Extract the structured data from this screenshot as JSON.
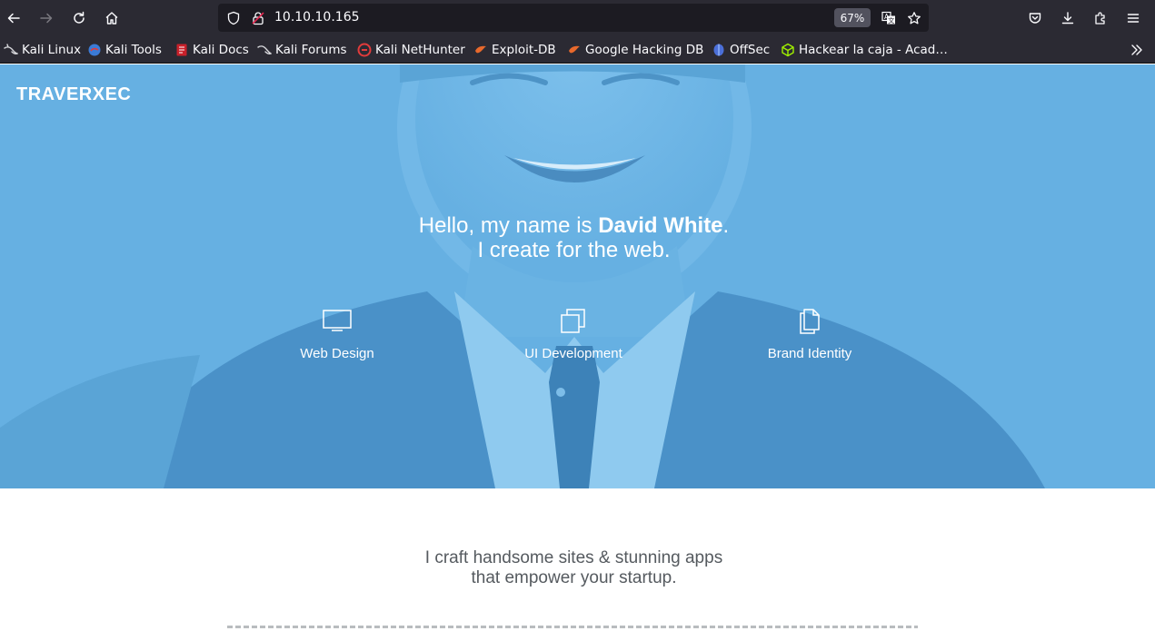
{
  "browser": {
    "url": "10.10.10.165",
    "zoom": "67%",
    "bookmarks": [
      {
        "label": "Kali Linux",
        "icon": "kali-dragon-icon"
      },
      {
        "label": "Kali Tools",
        "icon": "kali-tools-icon"
      },
      {
        "label": "Kali Docs",
        "icon": "kali-docs-icon"
      },
      {
        "label": "Kali Forums",
        "icon": "kali-dragon-icon"
      },
      {
        "label": "Kali NetHunter",
        "icon": "nethunter-icon"
      },
      {
        "label": "Exploit-DB",
        "icon": "exploit-db-icon"
      },
      {
        "label": "Google Hacking DB",
        "icon": "exploit-db-icon"
      },
      {
        "label": "OffSec",
        "icon": "offsec-icon"
      },
      {
        "label": "Hackear la caja - Acad…",
        "icon": "htb-cube-icon"
      }
    ]
  },
  "site": {
    "logo": "TRAVERXEC",
    "hero": {
      "greeting": "Hello, my name is ",
      "name": "David White",
      "greeting_end": ".",
      "tagline": "I create for the web."
    },
    "services": [
      {
        "label": "Web Design",
        "icon": "monitor-icon"
      },
      {
        "label": "UI Development",
        "icon": "windows-stack-icon"
      },
      {
        "label": "Brand Identity",
        "icon": "documents-icon"
      }
    ],
    "intro": {
      "line1": "I craft handsome sites & stunning apps",
      "line2": "that empower your startup."
    }
  },
  "colors": {
    "hero_overlay": "#66b0e2",
    "toolbar_bg": "#2b2a33",
    "urlbar_bg": "#1c1b22"
  }
}
